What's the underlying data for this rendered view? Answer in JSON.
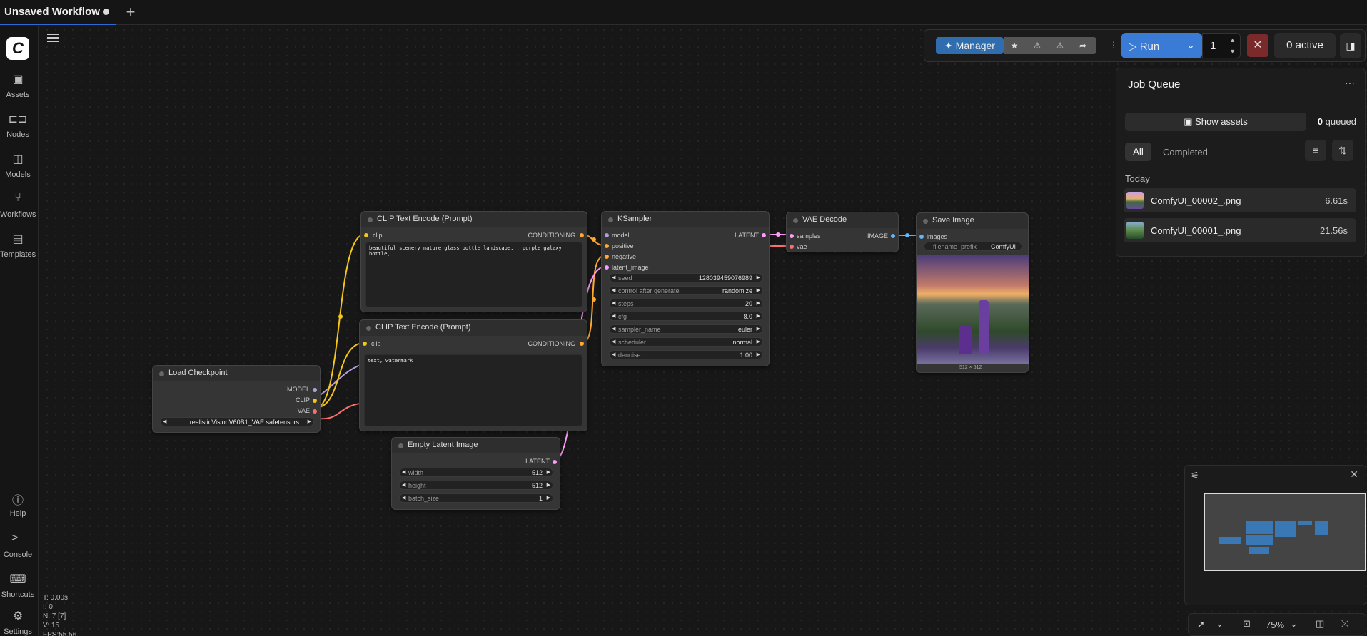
{
  "tabs": {
    "title": "Unsaved Workflow"
  },
  "sidebar": {
    "items": [
      {
        "label": "Assets",
        "icon": "image-icon"
      },
      {
        "label": "Nodes",
        "icon": "nodes-icon"
      },
      {
        "label": "Models",
        "icon": "models-icon"
      },
      {
        "label": "Workflows",
        "icon": "workflows-icon"
      },
      {
        "label": "Templates",
        "icon": "templates-icon"
      },
      {
        "label": "Help",
        "icon": "help-icon"
      },
      {
        "label": "Console",
        "icon": "console-icon"
      },
      {
        "label": "Shortcuts",
        "icon": "keyboard-icon"
      },
      {
        "label": "Settings",
        "icon": "gear-icon"
      }
    ]
  },
  "toolbar": {
    "manager_label": "Manager",
    "run_label": "Run",
    "batch_count": "1",
    "active_label": "0 active"
  },
  "job_queue": {
    "title": "Job Queue",
    "show_assets": "Show assets",
    "queued_count": "0",
    "queued_label": "queued",
    "tab_all": "All",
    "tab_completed": "Completed",
    "group": "Today",
    "jobs": [
      {
        "name": "ComfyUI_00002_.png",
        "time": "6.61s"
      },
      {
        "name": "ComfyUI_00001_.png",
        "time": "21.56s"
      }
    ]
  },
  "nodes": {
    "clip1": {
      "title": "CLIP Text Encode (Prompt)",
      "in": "clip",
      "out": "CONDITIONING",
      "text": "beautiful scenery nature glass bottle landscape, , purple galaxy bottle,"
    },
    "clip2": {
      "title": "CLIP Text Encode (Prompt)",
      "in": "clip",
      "out": "CONDITIONING",
      "text": "text, watermark"
    },
    "ksampler": {
      "title": "KSampler",
      "inputs": [
        "model",
        "positive",
        "negative",
        "latent_image"
      ],
      "out": "LATENT",
      "widgets": [
        {
          "label": "seed",
          "value": "128039459076989"
        },
        {
          "label": "control after generate",
          "value": "randomize"
        },
        {
          "label": "steps",
          "value": "20"
        },
        {
          "label": "cfg",
          "value": "8.0"
        },
        {
          "label": "sampler_name",
          "value": "euler"
        },
        {
          "label": "scheduler",
          "value": "normal"
        },
        {
          "label": "denoise",
          "value": "1.00"
        }
      ]
    },
    "vae": {
      "title": "VAE Decode",
      "in1": "samples",
      "in2": "vae",
      "out": "IMAGE"
    },
    "save": {
      "title": "Save Image",
      "in": "images",
      "prefix_label": "filename_prefix",
      "prefix_value": "ComfyUI",
      "size": "512 × 512"
    },
    "checkpoint": {
      "title": "Load Checkpoint",
      "out1": "MODEL",
      "out2": "CLIP",
      "out3": "VAE",
      "ckpt": "... realisticVisionV60B1_VAE.safetensors"
    },
    "latent": {
      "title": "Empty Latent Image",
      "out": "LATENT",
      "widgets": [
        {
          "label": "width",
          "value": "512"
        },
        {
          "label": "height",
          "value": "512"
        },
        {
          "label": "batch_size",
          "value": "1"
        }
      ]
    }
  },
  "bottom": {
    "zoom": "75%"
  },
  "stats": {
    "t": "T: 0.00s",
    "i": "I: 0",
    "n": "N: 7 [7]",
    "v": "V: 15",
    "fps": "FPS:55.56"
  },
  "colors": {
    "accent": "#3a7bd5",
    "clip": "#f5c518",
    "model": "#b39ddb",
    "vae": "#ff6e6e",
    "latent": "#ff9cf9",
    "image": "#64b5f6",
    "conditioning": "#ffa931"
  }
}
